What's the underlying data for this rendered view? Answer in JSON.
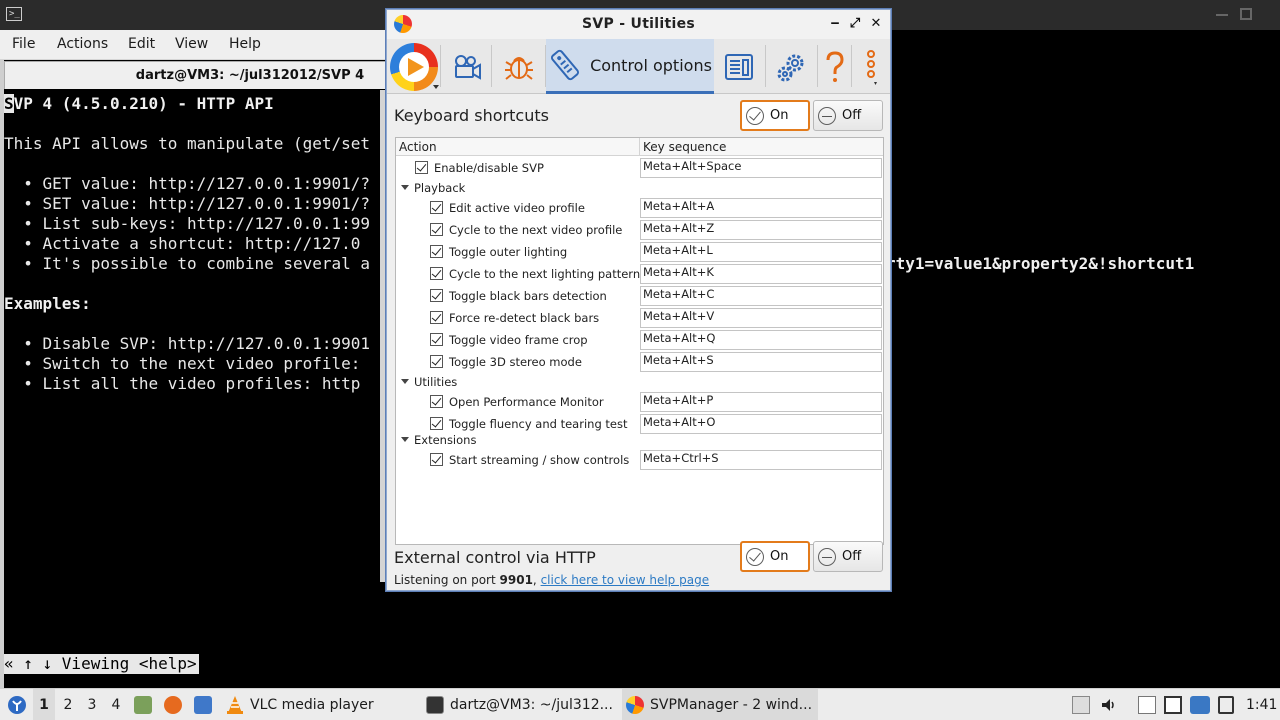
{
  "terminal": {
    "menu": [
      "File",
      "Actions",
      "Edit",
      "View",
      "Help"
    ],
    "window_title": "dartz@VM3: ~/jul312012/SVP 4",
    "cursor_char": "S",
    "lines": {
      "title": "VP 4 (4.5.0.210) - HTTP API",
      "intro": "This API allows to manipulate (get/set",
      "b1": "  • GET value: http://127.0.0.1:9901/?",
      "b2": "  • SET value: http://127.0.0.1:9901/?",
      "b3": "  • List sub-keys: http://127.0.0.1:99",
      "b4": "  • Activate a shortcut: http://127.0",
      "b5": "  • It's possible to combine several a",
      "b5_tail": "rty1=value1&property2&!shortcut1",
      "examples": "Examples:",
      "e1": "  • Disable SVP: http://127.0.0.1:9901",
      "e2": "  • Switch to the next video profile:",
      "e3": "  • List all the video profiles: http"
    },
    "status": "« ↑ ↓ Viewing <help>"
  },
  "svp": {
    "title": "SVP - Utilities",
    "window_buttons": {
      "minimize": "‒",
      "maximize": "⤢",
      "close": "✕"
    },
    "tabs": {
      "control_options": "Control options"
    },
    "keyboard": {
      "label": "Keyboard shortcuts",
      "on": "On",
      "off": "Off"
    },
    "table": {
      "col_action": "Action",
      "col_key": "Key sequence",
      "top_row": {
        "action": "Enable/disable SVP",
        "key": "Meta+Alt+Space"
      },
      "groups": [
        {
          "name": "Playback",
          "rows": [
            {
              "action": "Edit active video profile",
              "key": "Meta+Alt+A"
            },
            {
              "action": "Cycle to the next video profile",
              "key": "Meta+Alt+Z"
            },
            {
              "action": "Toggle outer lighting",
              "key": "Meta+Alt+L"
            },
            {
              "action": "Cycle to the next lighting pattern",
              "key": "Meta+Alt+K"
            },
            {
              "action": "Toggle black bars detection",
              "key": "Meta+Alt+C"
            },
            {
              "action": "Force re-detect black bars",
              "key": "Meta+Alt+V"
            },
            {
              "action": "Toggle video frame crop",
              "key": "Meta+Alt+Q"
            },
            {
              "action": "Toggle 3D stereo mode",
              "key": "Meta+Alt+S"
            }
          ]
        },
        {
          "name": "Utilities",
          "rows": [
            {
              "action": "Open Performance Monitor",
              "key": "Meta+Alt+P"
            },
            {
              "action": "Toggle fluency and tearing test",
              "key": "Meta+Alt+O"
            }
          ]
        },
        {
          "name": "Extensions",
          "rows": [
            {
              "action": "Start streaming / show controls",
              "key": "Meta+Ctrl+S"
            }
          ]
        }
      ]
    },
    "http": {
      "label": "External control via HTTP",
      "on": "On",
      "off": "Off",
      "listening_prefix": "Listening on port ",
      "port": "9901",
      "sep": ", ",
      "help_link": "click here to view help page"
    }
  },
  "taskbar": {
    "desktops": [
      "1",
      "2",
      "3",
      "4"
    ],
    "tasks": {
      "vlc": "VLC media player",
      "terminal": "dartz@VM3: ~/jul312...",
      "svp": "SVPManager - 2 wind..."
    },
    "clock": "1:41"
  }
}
